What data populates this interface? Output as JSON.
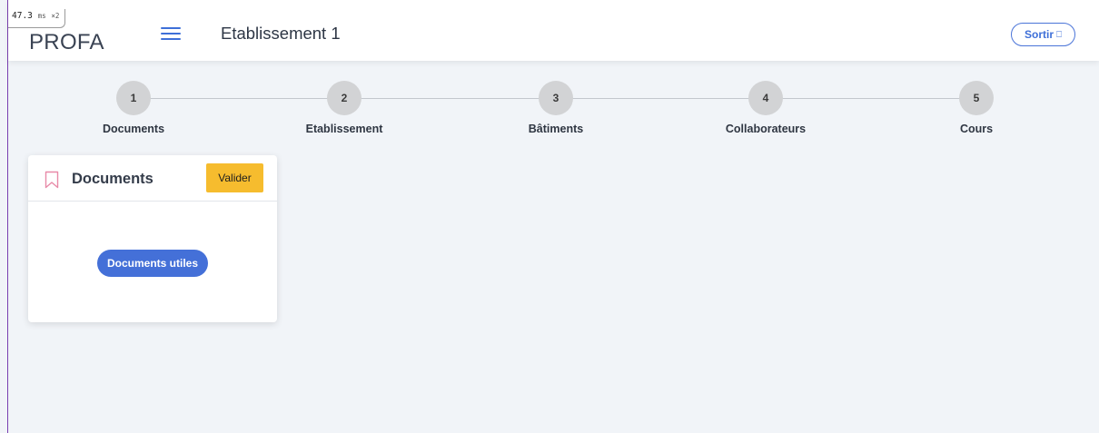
{
  "perf": {
    "value": "47.3",
    "unit": "ms",
    "multiplier": "×2"
  },
  "header": {
    "logo": "PROFA",
    "title": "Etablissement 1",
    "logout_label": "Sortir",
    "menu_icon": "hamburger-icon",
    "logout_icon": "exit-door-icon"
  },
  "stepper": {
    "steps": [
      {
        "number": "1",
        "label": "Documents"
      },
      {
        "number": "2",
        "label": "Etablissement"
      },
      {
        "number": "3",
        "label": "Bâtiments"
      },
      {
        "number": "4",
        "label": "Collaborateurs"
      },
      {
        "number": "5",
        "label": "Cours"
      }
    ]
  },
  "card": {
    "title": "Documents",
    "icon": "bookmark-icon",
    "validate_label": "Valider",
    "docs_button_label": "Documents utiles"
  },
  "colors": {
    "accent": "#4470d8",
    "validate": "#f6bc2e",
    "bookmark": "#e88aa8",
    "background": "#f1f4f8"
  }
}
